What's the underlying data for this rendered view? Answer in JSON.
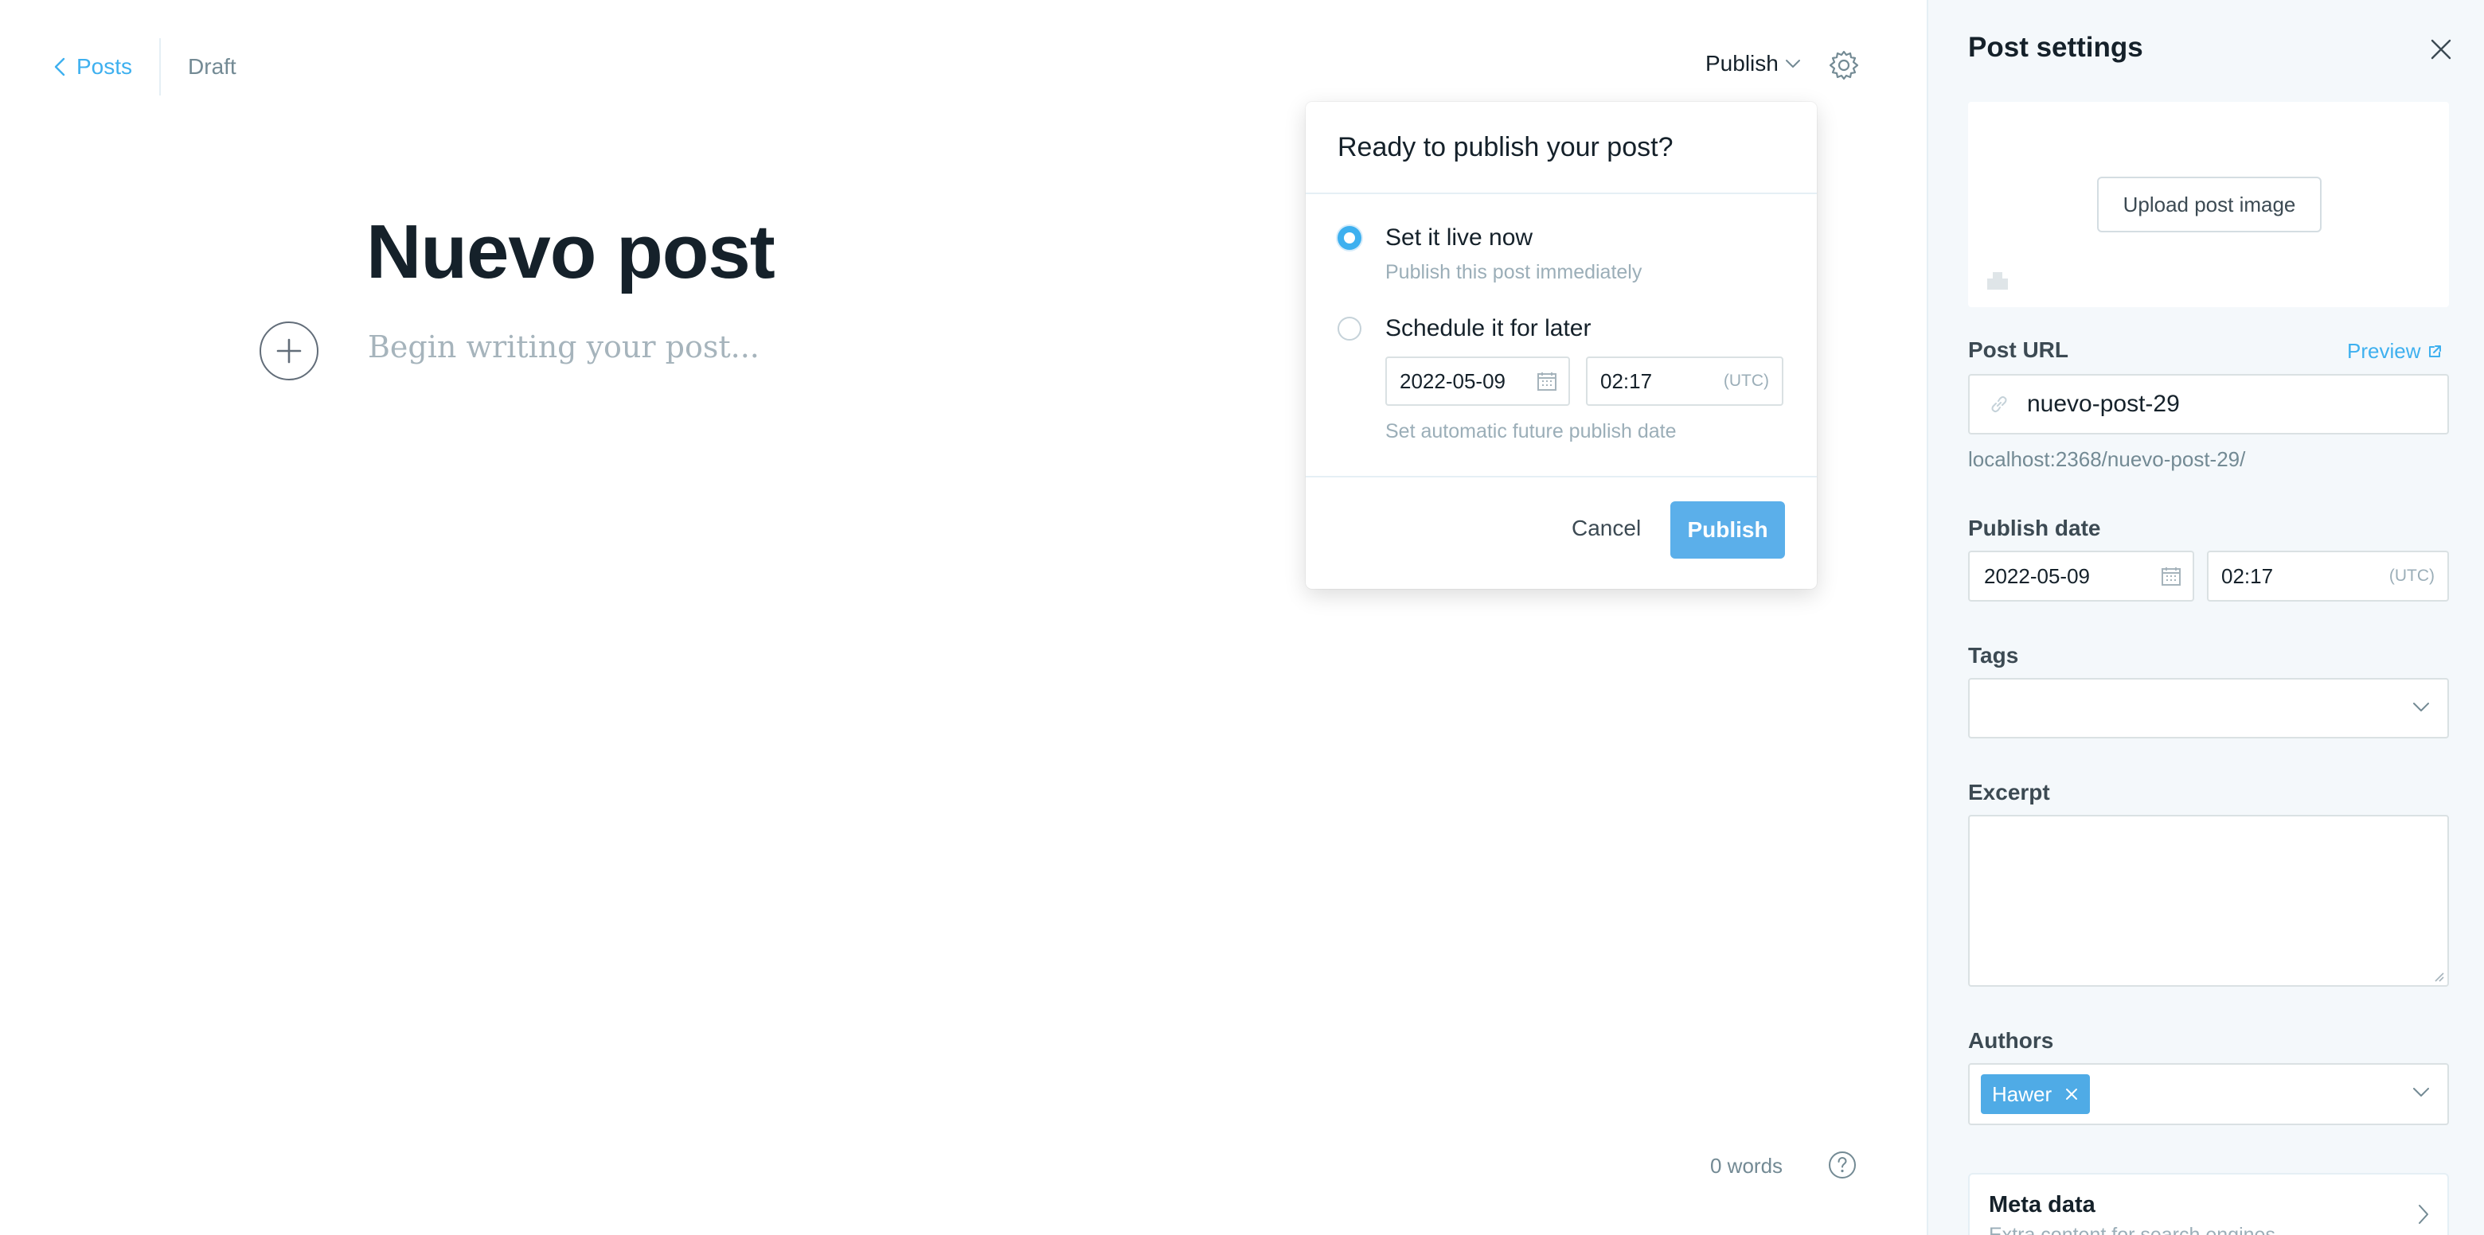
{
  "editor": {
    "back_label": "Posts",
    "status": "Draft",
    "publish_trigger": "Publish",
    "title": "Nuevo post",
    "body_placeholder": "Begin writing your post...",
    "word_count": "0 words"
  },
  "publish_menu": {
    "header": "Ready to publish your post?",
    "option_now": {
      "title": "Set it live now",
      "subtitle": "Publish this post immediately",
      "selected": true
    },
    "option_later": {
      "title": "Schedule it for later",
      "date": "2022-05-09",
      "time": "02:17",
      "tz": "(UTC)",
      "hint": "Set automatic future publish date",
      "selected": false
    },
    "cancel_label": "Cancel",
    "publish_label": "Publish"
  },
  "settings": {
    "title": "Post settings",
    "upload_label": "Upload post image",
    "url_label": "Post URL",
    "preview_label": "Preview",
    "slug": "nuevo-post-29",
    "url_hint": "localhost:2368/nuevo-post-29/",
    "publish_date_label": "Publish date",
    "publish_date": "2022-05-09",
    "publish_time": "02:17",
    "publish_tz": "(UTC)",
    "tags_label": "Tags",
    "excerpt_label": "Excerpt",
    "authors_label": "Authors",
    "authors": [
      "Hawer"
    ],
    "meta_title": "Meta data",
    "meta_subtitle": "Extra content for search engines"
  },
  "colors": {
    "accent": "#3eb0ef",
    "button": "#5bafea",
    "panel_bg": "#f4f8fb"
  }
}
